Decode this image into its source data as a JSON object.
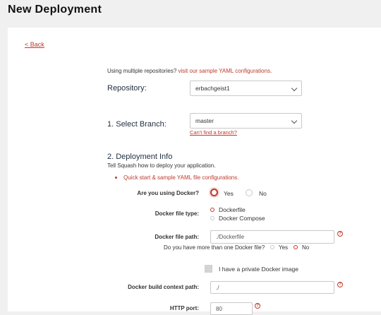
{
  "page": {
    "title": "New Deployment"
  },
  "nav": {
    "back_label": "< Back"
  },
  "hint": {
    "prefix": "Using multiple repositories?",
    "link": "visit our sample YAML configurations."
  },
  "repository": {
    "label": "Repository:",
    "value": "erbachgeist1"
  },
  "branch": {
    "label": "1. Select Branch:",
    "value": "master",
    "help_link": "Can't find a branch?"
  },
  "deployment_info": {
    "title": "2. Deployment Info",
    "description": "Tell Squash how to deploy your application.",
    "bullet_link": "Quick start & sample YAML file configurations."
  },
  "docker_question": {
    "label": "Are you using Docker?",
    "options": [
      "Yes",
      "No"
    ],
    "selected": "Yes"
  },
  "docker_file_type": {
    "label": "Docker file type:",
    "options": [
      "Dockerfile",
      "Docker Compose"
    ],
    "selected": "Dockerfile"
  },
  "docker_file_path": {
    "label": "Docker file path:",
    "value": "./Dockerfile",
    "help_icon": "?"
  },
  "multiple_docker": {
    "question": "Do you have more than one Docker file?",
    "options": [
      "Yes",
      "No"
    ],
    "selected": "No"
  },
  "private_image": {
    "label": "I have a private Docker image",
    "checked": false
  },
  "build_context": {
    "label": "Docker build context path:",
    "value": "./",
    "help_icon": "?"
  },
  "http_port": {
    "label": "HTTP port:",
    "value": "80",
    "help_icon": "?"
  },
  "colors": {
    "accent": "#c0392b",
    "background": "#f0f0f0",
    "card": "#ffffff"
  }
}
